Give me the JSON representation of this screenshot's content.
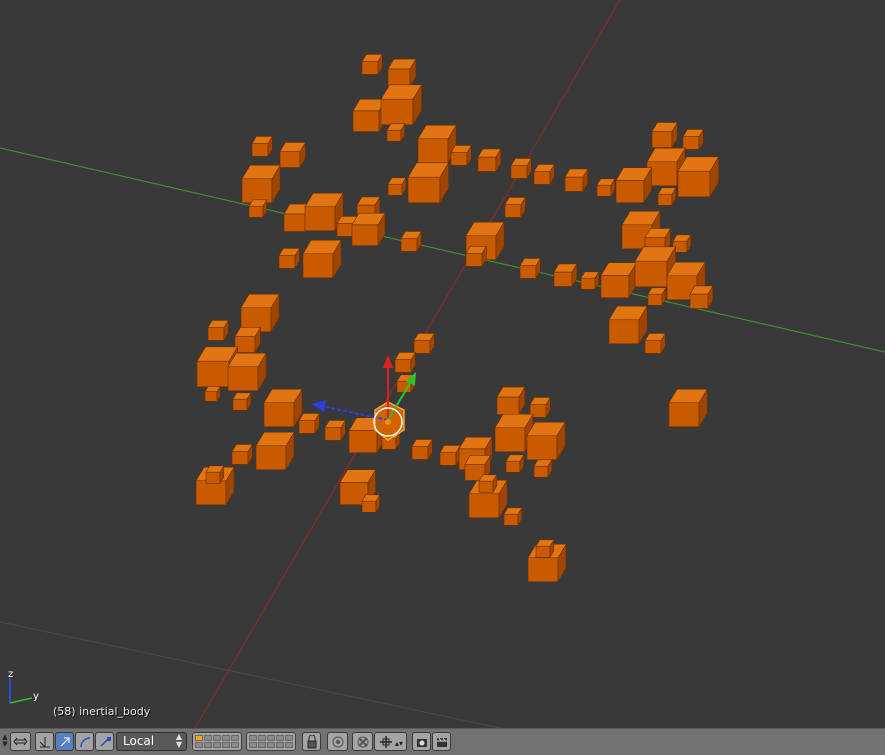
{
  "viewport": {
    "info_text": "(58) inertial_body",
    "background": "#393939",
    "object_color": "#c85a00",
    "axis_x_color": "#8b2a2a",
    "axis_y_color": "#3f8f30"
  },
  "mini_axes": {
    "z_label": "z",
    "y_label": "y"
  },
  "header": {
    "transform_orientation": "Local",
    "icons": [
      "view-rotate-icon",
      "manipulator-axis-icon",
      "translate-icon",
      "rotate-icon",
      "scale-icon",
      "layers-grid-1",
      "layers-grid-2",
      "lock-icon",
      "proportional-edit-icon",
      "snap-icon",
      "snap-target-icon",
      "render-icon",
      "render-animation-icon"
    ]
  }
}
